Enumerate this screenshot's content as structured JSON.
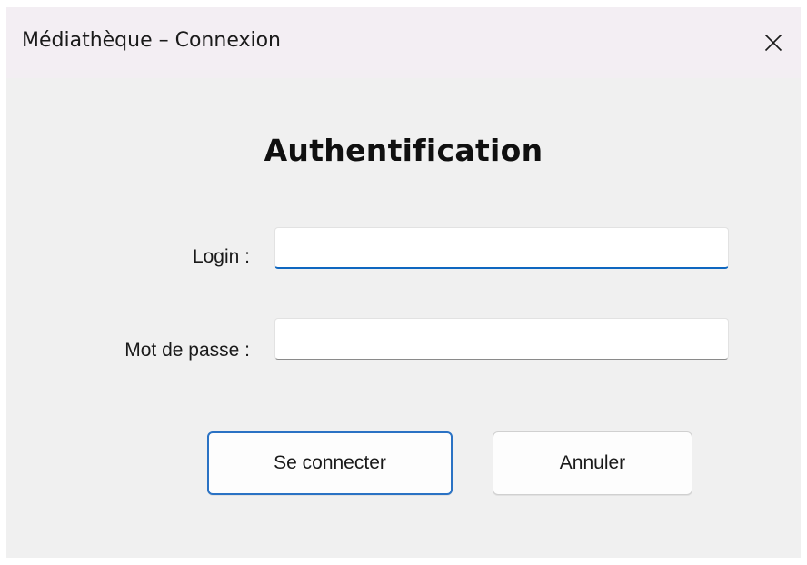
{
  "window": {
    "title": "Médiathèque – Connexion",
    "close_icon": "close-icon"
  },
  "form": {
    "heading": "Authentification",
    "login_label": "Login :",
    "login_value": "",
    "password_label": "Mot de passe :",
    "password_value": ""
  },
  "buttons": {
    "connect_label": "Se connecter",
    "cancel_label": "Annuler"
  },
  "colors": {
    "accent": "#0f67c0",
    "window_bg": "#f0f0f0",
    "titlebar_bg": "#f3eef3"
  }
}
